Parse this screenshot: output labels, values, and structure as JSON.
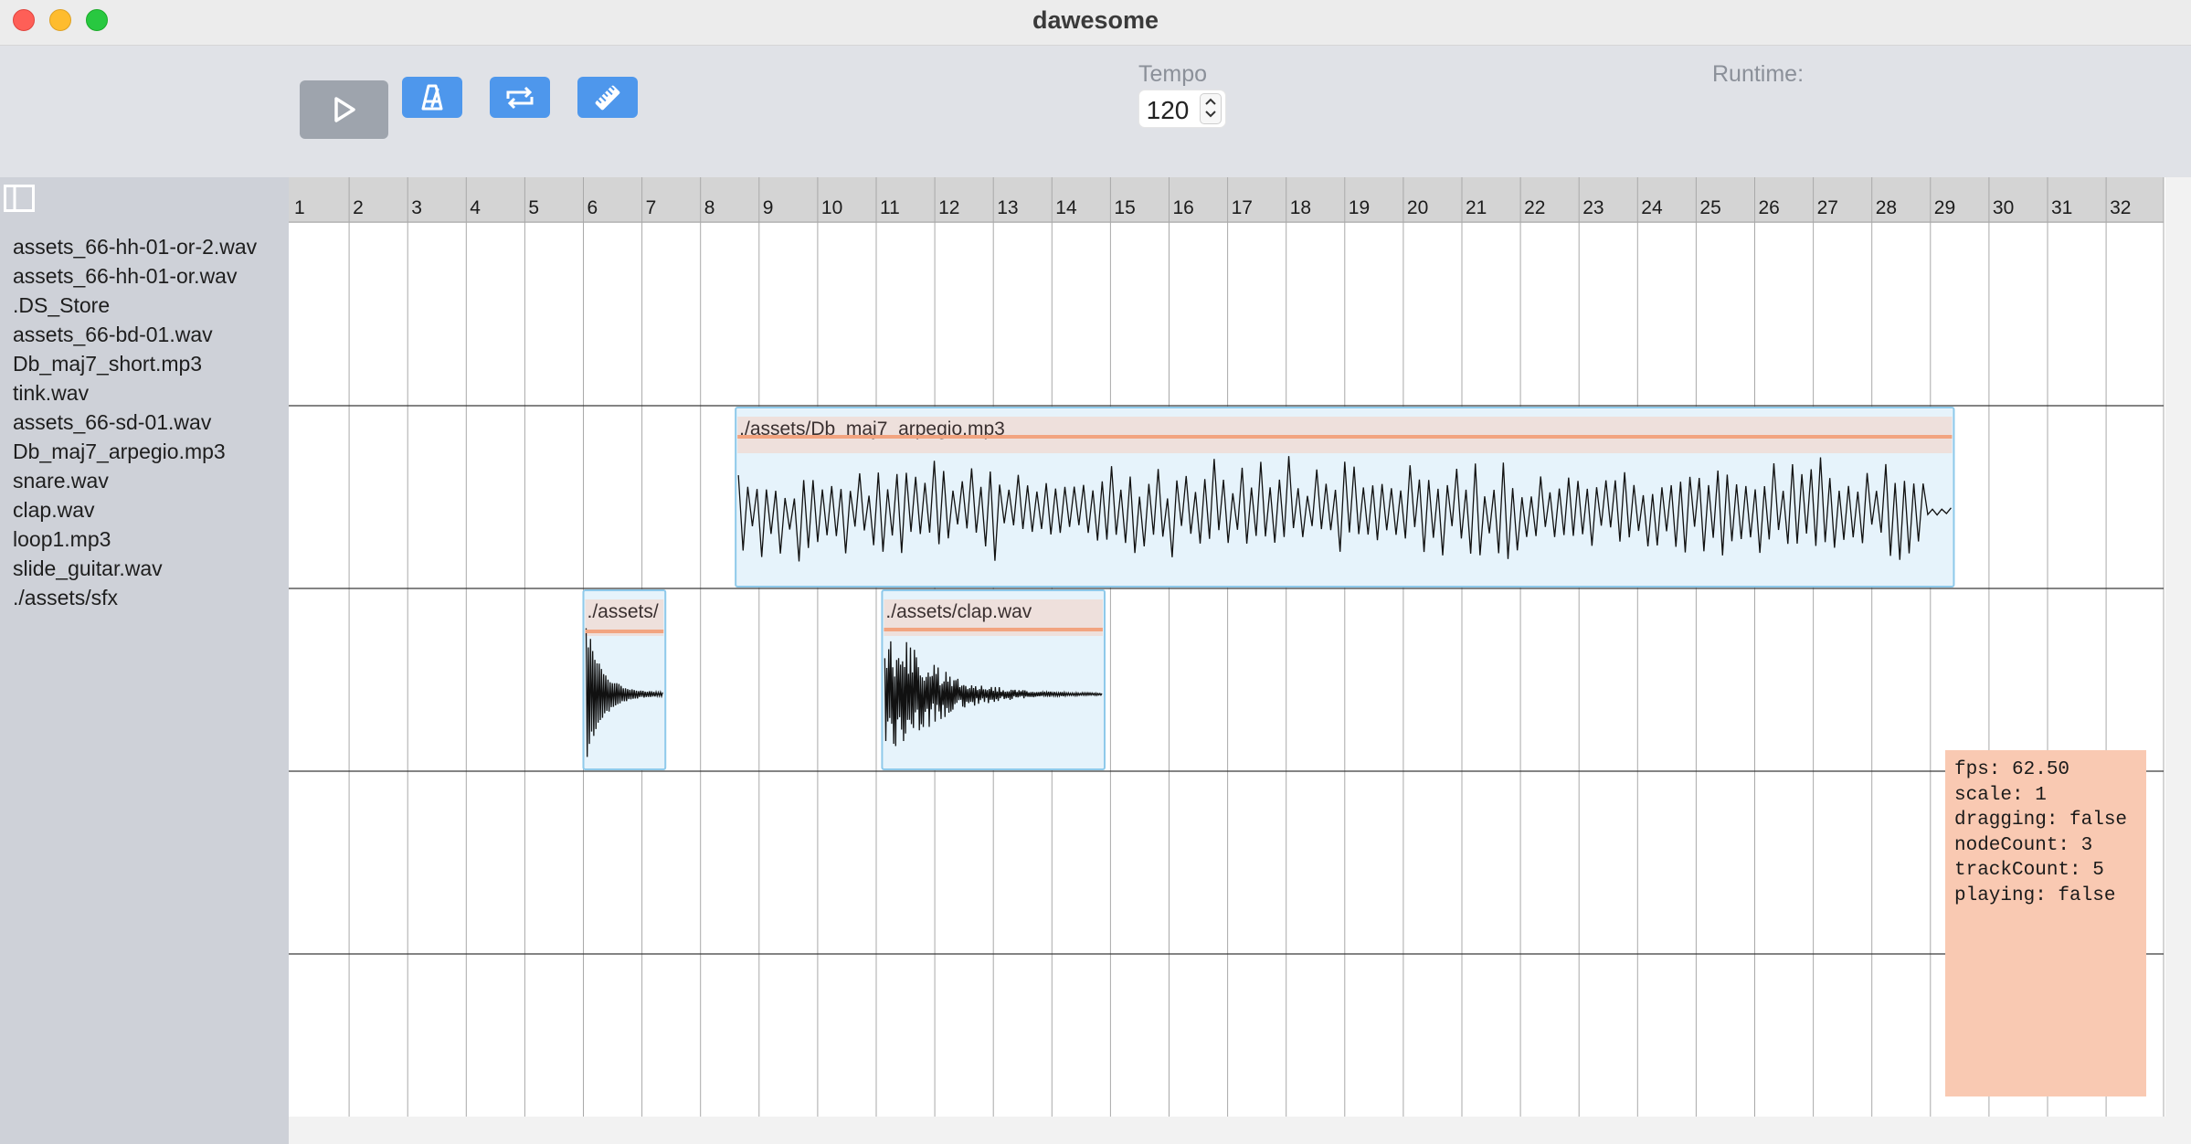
{
  "window": {
    "title": "dawesome"
  },
  "toolbar": {
    "tempo_label": "Tempo",
    "tempo_value": "120",
    "runtime_label": "Runtime:",
    "buttons": [
      "play-icon",
      "metronome-icon",
      "loop-icon",
      "ruler-icon"
    ]
  },
  "sidebar": {
    "files": [
      "assets_66-hh-01-or-2.wav",
      "assets_66-hh-01-or.wav",
      ".DS_Store",
      "assets_66-bd-01.wav",
      "Db_maj7_short.mp3",
      "tink.wav",
      "assets_66-sd-01.wav",
      "Db_maj7_arpegio.mp3",
      "snare.wav",
      "clap.wav",
      "loop1.mp3",
      "slide_guitar.wav",
      "./assets/sfx"
    ]
  },
  "timeline": {
    "bars": [
      "1",
      "2",
      "3",
      "4",
      "5",
      "6",
      "7",
      "8",
      "9",
      "10",
      "11",
      "12",
      "13",
      "14",
      "15",
      "16",
      "17",
      "18",
      "19",
      "20",
      "21",
      "22",
      "23",
      "24",
      "25",
      "26",
      "27",
      "28",
      "29",
      "30",
      "31",
      "32"
    ],
    "track_count": 5,
    "clips": [
      {
        "label": "./assets/Db_maj7_arpegio.mp3",
        "track": 1,
        "start_bar": 8.6,
        "end_bar": 29.4,
        "volume": 0.5,
        "waveform": "arpeggio"
      },
      {
        "label": "./assets/",
        "track": 2,
        "start_bar": 6.0,
        "end_bar": 7.4,
        "volume": 0.5,
        "waveform": "decay"
      },
      {
        "label": "./assets/clap.wav",
        "track": 2,
        "start_bar": 11.1,
        "end_bar": 14.9,
        "volume": 0.55,
        "waveform": "burst"
      }
    ]
  },
  "debug": {
    "lines": [
      "fps: 62.50",
      "scale: 1",
      "dragging: false",
      "nodeCount: 3",
      "trackCount: 5",
      "playing: false"
    ]
  },
  "colors": {
    "accent": "#4e97ec",
    "clip_fill": "#e6f3fb",
    "clip_border": "#8ec9ea",
    "clip_header": "#eee0dc",
    "volume_line": "#f2a480",
    "debug_bg": "#f9c9b2"
  }
}
